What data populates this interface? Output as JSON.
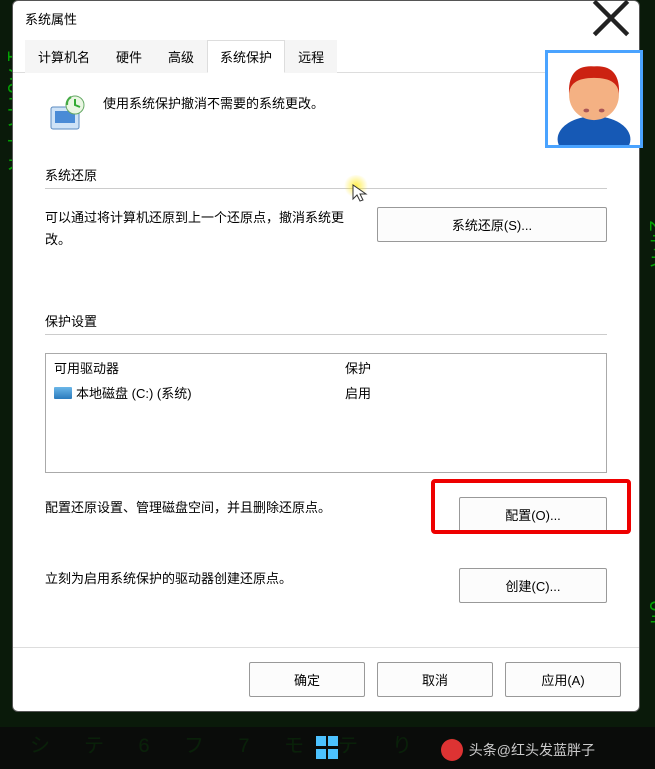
{
  "window": {
    "title": "系统属性"
  },
  "tabs": {
    "items": [
      {
        "label": "计算机名"
      },
      {
        "label": "硬件"
      },
      {
        "label": "高级"
      },
      {
        "label": "系统保护"
      },
      {
        "label": "远程"
      }
    ],
    "active_index": 3
  },
  "intro_text": "使用系统保护撤消不需要的系统更改。",
  "sections": {
    "restore": {
      "title": "系统还原",
      "desc": "可以通过将计算机还原到上一个还原点，撤消系统更改。",
      "button": "系统还原(S)..."
    },
    "protection": {
      "title": "保护设置",
      "table": {
        "head_drive": "可用驱动器",
        "head_prot": "保护",
        "rows": [
          {
            "name": "本地磁盘 (C:) (系统)",
            "prot": "启用"
          }
        ]
      },
      "configure_desc": "配置还原设置、管理磁盘空间，并且删除还原点。",
      "configure_button": "配置(O)...",
      "create_desc": "立刻为启用系统保护的驱动器创建还原点。",
      "create_button": "创建(C)..."
    }
  },
  "footer": {
    "ok": "确定",
    "cancel": "取消",
    "apply": "应用(A)"
  },
  "attribution": "头条@红头发蓝胖子"
}
